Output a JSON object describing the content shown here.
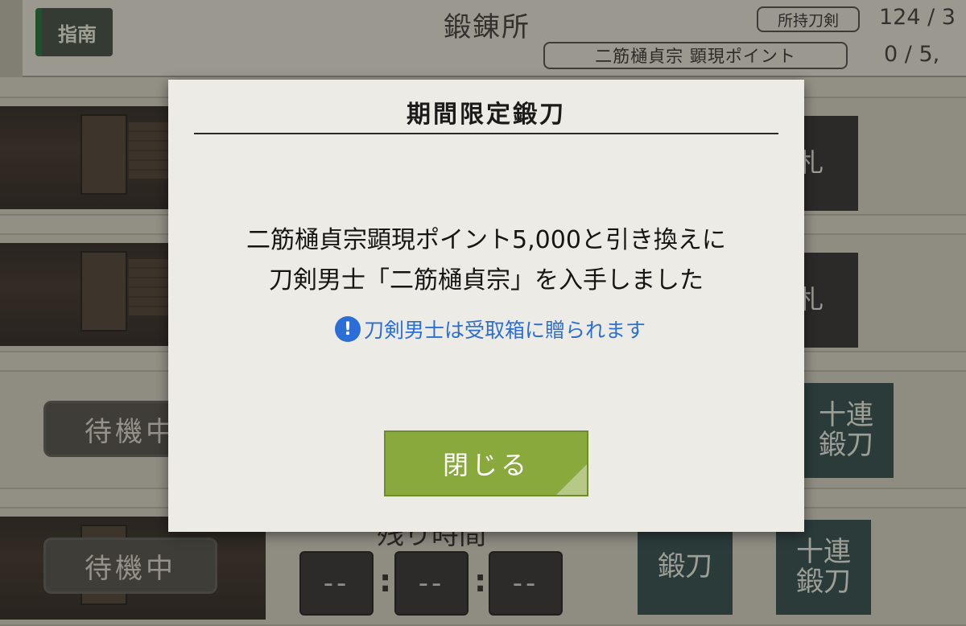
{
  "header": {
    "guide_label": "指南",
    "title": "鍛錬所",
    "owned_label": "所持刀剣",
    "owned_count": "124 / 3",
    "point_label": "二筋樋貞宗 顕現ポイント",
    "point_count": "0 / 5,"
  },
  "rows": [
    {
      "action_label": "札"
    },
    {
      "action_label": "札"
    },
    {
      "status_label": "待機中",
      "forge_label": "十連\n鍛刀"
    },
    {
      "status_label": "待機中",
      "forge_label": "鍛刀",
      "forge10_label": "十連\n鍛刀"
    }
  ],
  "timer": {
    "label": "残り時間",
    "hours": "--",
    "minutes": "--",
    "seconds": "--"
  },
  "dialog": {
    "title": "期間限定鍛刀",
    "message_line1": "二筋樋貞宗顕現ポイント5,000と引き換えに",
    "message_line2": "刀剣男士「二筋樋貞宗」を入手しました",
    "notice_icon": "!",
    "notice_text": "刀剣男士は受取箱に贈られます",
    "close_label": "閉じる"
  },
  "colors": {
    "notice_blue": "#2b6fd6",
    "close_green": "#8aa93c"
  }
}
